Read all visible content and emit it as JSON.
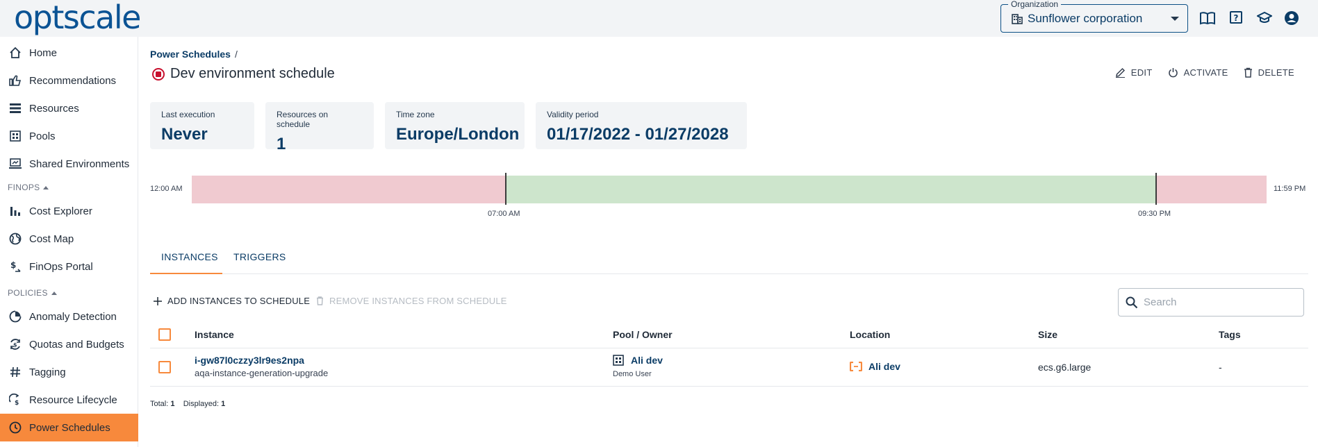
{
  "header": {
    "logo": "optscale",
    "organization": {
      "legend": "Organization",
      "value": "Sunflower corporation"
    },
    "icons": [
      "documentation-icon",
      "help-icon",
      "academy-icon",
      "account-icon"
    ]
  },
  "sidebar": {
    "items_top": [
      {
        "label": "Home",
        "icon": "home-icon"
      },
      {
        "label": "Recommendations",
        "icon": "thumbs-up-icon"
      },
      {
        "label": "Resources",
        "icon": "list-icon"
      },
      {
        "label": "Pools",
        "icon": "pools-icon"
      },
      {
        "label": "Shared Environments",
        "icon": "environment-icon"
      }
    ],
    "section_finops": "FINOPS",
    "items_finops": [
      {
        "label": "Cost Explorer",
        "icon": "bar-chart-icon"
      },
      {
        "label": "Cost Map",
        "icon": "globe-icon"
      },
      {
        "label": "FinOps Portal",
        "icon": "finops-icon"
      }
    ],
    "section_policies": "POLICIES",
    "items_policies": [
      {
        "label": "Anomaly Detection",
        "icon": "anomaly-icon"
      },
      {
        "label": "Quotas and Budgets",
        "icon": "quota-icon"
      },
      {
        "label": "Tagging",
        "icon": "hash-icon"
      },
      {
        "label": "Resource Lifecycle",
        "icon": "lifecycle-icon"
      },
      {
        "label": "Power Schedules",
        "icon": "clock-icon"
      }
    ]
  },
  "main": {
    "breadcrumb": "Power Schedules",
    "breadcrumb_sep": "/",
    "title": "Dev environment schedule",
    "actions": {
      "edit": "EDIT",
      "activate": "ACTIVATE",
      "delete": "DELETE"
    },
    "cards": [
      {
        "label": "Last execution",
        "value": "Never"
      },
      {
        "label": "Resources on schedule",
        "value": "1"
      },
      {
        "label": "Time zone",
        "value": "Europe/London"
      },
      {
        "label": "Validity period",
        "value": "01/17/2022 - 01/27/2028"
      }
    ],
    "timeline": {
      "start_label": "12:00 AM",
      "end_label": "11:59 PM",
      "on_label": "07:00 AM",
      "off_label": "09:30 PM"
    },
    "tabs": {
      "instances": "INSTANCES",
      "triggers": "TRIGGERS"
    },
    "toolbar": {
      "add": "ADD INSTANCES TO SCHEDULE",
      "remove": "REMOVE INSTANCES FROM SCHEDULE",
      "search_placeholder": "Search"
    },
    "table": {
      "columns": [
        "Instance",
        "Pool / Owner",
        "Location",
        "Size",
        "Tags"
      ],
      "rows": [
        {
          "instance_id": "i-gw87l0czzy3lr9es2npa",
          "instance_name": "aqa-instance-generation-upgrade",
          "pool": "Ali dev",
          "owner": "Demo User",
          "location": "Ali dev",
          "size": "ecs.g6.large",
          "tags": "-"
        }
      ]
    },
    "footer": {
      "total_label": "Total:",
      "total": "1",
      "displayed_label": "Displayed:",
      "displayed": "1"
    }
  },
  "colors": {
    "accent": "#f7893c",
    "brand": "#0b3c66",
    "off": "#f0cad0",
    "on": "#cde5cc",
    "status_stopped": "#c8102e"
  }
}
